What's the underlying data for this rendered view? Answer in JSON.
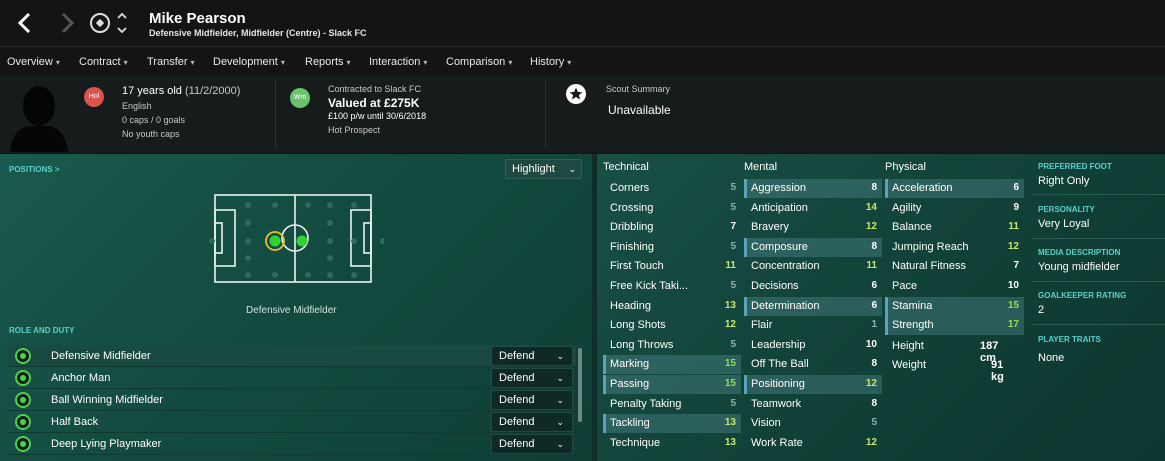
{
  "header": {
    "player_name": "Mike Pearson",
    "player_subtitle": "Defensive Midfielder, Midfielder (Centre) - Slack FC"
  },
  "menu": [
    {
      "label": "Overview",
      "active": true
    },
    {
      "label": "Contract"
    },
    {
      "label": "Transfer"
    },
    {
      "label": "Development"
    },
    {
      "label": "Reports"
    },
    {
      "label": "Interaction"
    },
    {
      "label": "Comparison"
    },
    {
      "label": "History"
    }
  ],
  "profile": {
    "age": "17 years old",
    "dob": "(11/2/2000)",
    "nationality": "English",
    "caps": "0 caps / 0 goals",
    "youth_caps": "No youth caps",
    "status_badge": "Hol",
    "status_badge_color": "#d9534f"
  },
  "contract": {
    "badge": "Wnt",
    "badge_color": "#6cc26c",
    "contracted_to": "Contracted to Slack FC",
    "value": "Valued at £275K",
    "wage": "£100 p/w until 30/6/2018",
    "status": "Hot Prospect"
  },
  "scout": {
    "title": "Scout Summary",
    "value": "Unavailable"
  },
  "positions": {
    "section_title": "POSITIONS >",
    "highlight_label": "Highlight",
    "caption": "Defensive Midfielder"
  },
  "roles": {
    "section_title": "ROLE AND DUTY",
    "items": [
      {
        "name": "Defensive Midfielder",
        "duty": "Defend"
      },
      {
        "name": "Anchor Man",
        "duty": "Defend"
      },
      {
        "name": "Ball Winning Midfielder",
        "duty": "Defend"
      },
      {
        "name": "Half Back",
        "duty": "Defend"
      },
      {
        "name": "Deep Lying Playmaker",
        "duty": "Defend"
      }
    ]
  },
  "attributes": {
    "technical": {
      "title": "Technical",
      "items": [
        {
          "label": "Corners",
          "value": "5"
        },
        {
          "label": "Crossing",
          "value": "5"
        },
        {
          "label": "Dribbling",
          "value": "7"
        },
        {
          "label": "Finishing",
          "value": "5"
        },
        {
          "label": "First Touch",
          "value": "11"
        },
        {
          "label": "Free Kick Taki...",
          "value": "5"
        },
        {
          "label": "Heading",
          "value": "13"
        },
        {
          "label": "Long Shots",
          "value": "12"
        },
        {
          "label": "Long Throws",
          "value": "5"
        },
        {
          "label": "Marking",
          "value": "15"
        },
        {
          "label": "Passing",
          "value": "15"
        },
        {
          "label": "Penalty Taking",
          "value": "5"
        },
        {
          "label": "Tackling",
          "value": "13"
        },
        {
          "label": "Technique",
          "value": "13"
        }
      ]
    },
    "mental": {
      "title": "Mental",
      "items": [
        {
          "label": "Aggression",
          "value": "8"
        },
        {
          "label": "Anticipation",
          "value": "14"
        },
        {
          "label": "Bravery",
          "value": "12"
        },
        {
          "label": "Composure",
          "value": "8"
        },
        {
          "label": "Concentration",
          "value": "11"
        },
        {
          "label": "Decisions",
          "value": "6"
        },
        {
          "label": "Determination",
          "value": "6"
        },
        {
          "label": "Flair",
          "value": "1"
        },
        {
          "label": "Leadership",
          "value": "10"
        },
        {
          "label": "Off The Ball",
          "value": "8"
        },
        {
          "label": "Positioning",
          "value": "12"
        },
        {
          "label": "Teamwork",
          "value": "8"
        },
        {
          "label": "Vision",
          "value": "5"
        },
        {
          "label": "Work Rate",
          "value": "12"
        }
      ]
    },
    "physical": {
      "title": "Physical",
      "items": [
        {
          "label": "Acceleration",
          "value": "6"
        },
        {
          "label": "Agility",
          "value": "9"
        },
        {
          "label": "Balance",
          "value": "11"
        },
        {
          "label": "Jumping Reach",
          "value": "12"
        },
        {
          "label": "Natural Fitness",
          "value": "7"
        },
        {
          "label": "Pace",
          "value": "10"
        },
        {
          "label": "Stamina",
          "value": "15"
        },
        {
          "label": "Strength",
          "value": "17"
        }
      ]
    },
    "measurements": {
      "height_label": "Height",
      "height_value": "187 cm",
      "weight_label": "Weight",
      "weight_value": "91 kg"
    }
  },
  "sidebar": {
    "preferred_foot_title": "PREFERRED FOOT",
    "preferred_foot": "Right Only",
    "personality_title": "PERSONALITY",
    "personality": "Very Loyal",
    "media_title": "MEDIA DESCRIPTION",
    "media": "Young midfielder",
    "gk_title": "GOALKEEPER RATING",
    "gk": "2",
    "traits_title": "PLAYER TRAITS",
    "traits": "None"
  }
}
